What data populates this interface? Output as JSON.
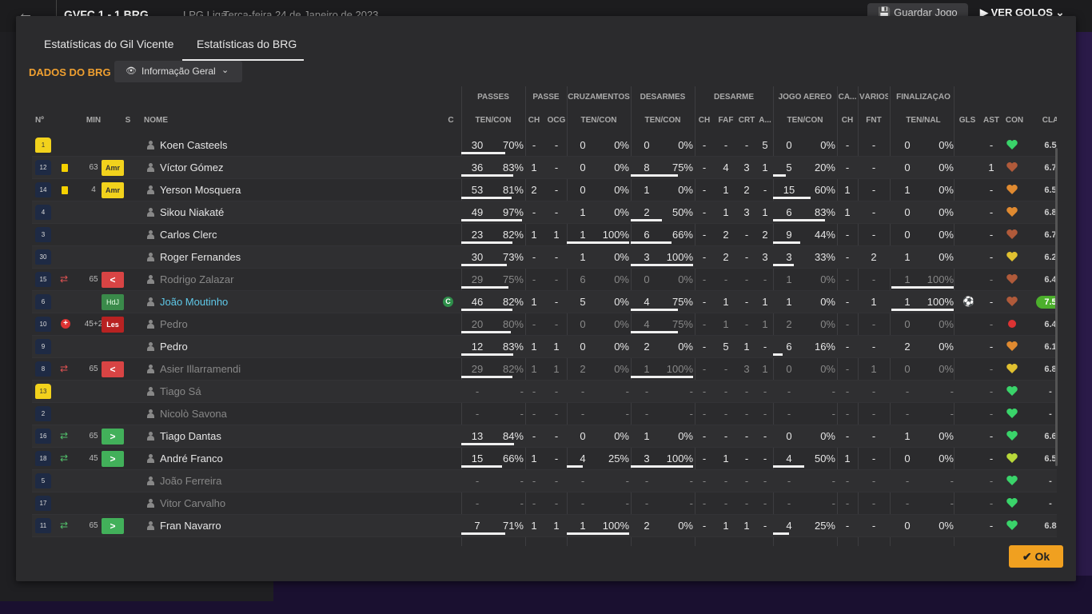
{
  "background": {
    "score": "GVFC 1 - 1 BRG",
    "league": "LPG Liga",
    "date": "Terça-feira 24 de Janeiro de 2023",
    "save_label": "Guardar Jogo",
    "goals_label": "VER GOLOS"
  },
  "tabs": [
    {
      "label": "Estatísticas do Gil Vicente",
      "active": false
    },
    {
      "label": "Estatísticas do BRG",
      "active": true
    }
  ],
  "team_title": "DADOS DO BRG",
  "view_dropdown": {
    "label": "Informação Geral"
  },
  "groups": [
    "PASSES",
    "PASSE",
    "CRUZAMENTOS",
    "DESARMES",
    "DESARME",
    "JOGO AÉREO",
    "CA...",
    "VÁRIOS",
    "FINALIZAÇÃO"
  ],
  "columns": [
    "Nº",
    "MIN",
    "S",
    "NOME",
    "C",
    "TEN/CON",
    "CH",
    "OCG",
    "TEN/CON",
    "TEN/CON",
    "CH",
    "FAF",
    "CRT",
    "A...",
    "TEN/CON",
    "CH",
    "FNT",
    "TEN/NAL",
    "GLS",
    "AST",
    "CON",
    "CLA"
  ],
  "colors": {
    "accent": "#f0a030",
    "best_rating": "#4caf2c",
    "ok_button": "#f0a020"
  },
  "players": [
    {
      "num": "1",
      "gk": true,
      "min": "",
      "card": "",
      "sub": "",
      "status": "",
      "name": "Koen Casteels",
      "active": true,
      "cap": false,
      "pass": [
        "30",
        "70%"
      ],
      "passp": 0.7,
      "ch": "-",
      "ocg": "-",
      "cru": [
        "0",
        "0%"
      ],
      "crup": 0,
      "des": [
        "0",
        "0%"
      ],
      "desp": 0,
      "dch": "-",
      "faf": "-",
      "crt": "-",
      "a": "5",
      "aer": [
        "0",
        "0%"
      ],
      "aerp": 0,
      "cach": "-",
      "fnt": "-",
      "fin": [
        "0",
        "0%"
      ],
      "finp": 0,
      "gls": "",
      "ast": "-",
      "con": "green",
      "cla": "6.5",
      "best": false
    },
    {
      "num": "12",
      "gk": false,
      "min": "63",
      "card": "yellow",
      "sub": "",
      "status": "Amr",
      "name": "Víctor Gómez",
      "active": true,
      "cap": false,
      "pass": [
        "36",
        "83%"
      ],
      "passp": 0.83,
      "ch": "1",
      "ocg": "-",
      "cru": [
        "0",
        "0%"
      ],
      "crup": 0,
      "des": [
        "8",
        "75%"
      ],
      "desp": 0.75,
      "dch": "-",
      "faf": "4",
      "crt": "3",
      "a": "1",
      "aer": [
        "5",
        "20%"
      ],
      "aerp": 0.2,
      "cach": "-",
      "fnt": "-",
      "fin": [
        "0",
        "0%"
      ],
      "finp": 0,
      "gls": "",
      "ast": "1",
      "con": "brown",
      "cla": "6.7",
      "best": false
    },
    {
      "num": "14",
      "gk": false,
      "min": "4",
      "card": "yellow",
      "sub": "",
      "status": "Amr",
      "name": "Yerson Mosquera",
      "active": true,
      "cap": false,
      "pass": [
        "53",
        "81%"
      ],
      "passp": 0.81,
      "ch": "2",
      "ocg": "-",
      "cru": [
        "0",
        "0%"
      ],
      "crup": 0,
      "des": [
        "1",
        "0%"
      ],
      "desp": 0,
      "dch": "-",
      "faf": "1",
      "crt": "2",
      "a": "-",
      "aer": [
        "15",
        "60%"
      ],
      "aerp": 0.6,
      "cach": "1",
      "fnt": "-",
      "fin": [
        "1",
        "0%"
      ],
      "finp": 0,
      "gls": "",
      "ast": "-",
      "con": "orange",
      "cla": "6.5",
      "best": false
    },
    {
      "num": "4",
      "gk": false,
      "min": "",
      "card": "",
      "sub": "",
      "status": "",
      "name": "Sikou Niakaté",
      "active": true,
      "cap": false,
      "pass": [
        "49",
        "97%"
      ],
      "passp": 0.97,
      "ch": "-",
      "ocg": "-",
      "cru": [
        "1",
        "0%"
      ],
      "crup": 0,
      "des": [
        "2",
        "50%"
      ],
      "desp": 0.5,
      "dch": "-",
      "faf": "1",
      "crt": "3",
      "a": "1",
      "aer": [
        "6",
        "83%"
      ],
      "aerp": 0.83,
      "cach": "1",
      "fnt": "-",
      "fin": [
        "0",
        "0%"
      ],
      "finp": 0,
      "gls": "",
      "ast": "-",
      "con": "orange",
      "cla": "6.8",
      "best": false
    },
    {
      "num": "3",
      "gk": false,
      "min": "",
      "card": "",
      "sub": "",
      "status": "",
      "name": "Carlos Clerc",
      "active": true,
      "cap": false,
      "pass": [
        "23",
        "82%"
      ],
      "passp": 0.82,
      "ch": "1",
      "ocg": "1",
      "cru": [
        "1",
        "100%"
      ],
      "crup": 1,
      "des": [
        "6",
        "66%"
      ],
      "desp": 0.66,
      "dch": "-",
      "faf": "2",
      "crt": "-",
      "a": "2",
      "aer": [
        "9",
        "44%"
      ],
      "aerp": 0.44,
      "cach": "-",
      "fnt": "-",
      "fin": [
        "0",
        "0%"
      ],
      "finp": 0,
      "gls": "",
      "ast": "-",
      "con": "brown",
      "cla": "6.7",
      "best": false
    },
    {
      "num": "30",
      "gk": false,
      "min": "",
      "card": "",
      "sub": "",
      "status": "",
      "name": "Roger Fernandes",
      "active": true,
      "cap": false,
      "pass": [
        "30",
        "73%"
      ],
      "passp": 0.73,
      "ch": "-",
      "ocg": "-",
      "cru": [
        "1",
        "0%"
      ],
      "crup": 0,
      "des": [
        "3",
        "100%"
      ],
      "desp": 1,
      "dch": "-",
      "faf": "2",
      "crt": "-",
      "a": "3",
      "aer": [
        "3",
        "33%"
      ],
      "aerp": 0.33,
      "cach": "-",
      "fnt": "2",
      "fin": [
        "1",
        "0%"
      ],
      "finp": 0,
      "gls": "",
      "ast": "-",
      "con": "yellow",
      "cla": "6.2",
      "best": false
    },
    {
      "num": "15",
      "gk": false,
      "min": "65",
      "card": "",
      "sub": "out",
      "status": "out",
      "name": "Rodrigo Zalazar",
      "active": false,
      "cap": false,
      "pass": [
        "29",
        "75%"
      ],
      "passp": 0.75,
      "ch": "-",
      "ocg": "-",
      "cru": [
        "6",
        "0%"
      ],
      "crup": 0,
      "des": [
        "0",
        "0%"
      ],
      "desp": 0,
      "dch": "-",
      "faf": "-",
      "crt": "-",
      "a": "-",
      "aer": [
        "1",
        "0%"
      ],
      "aerp": 0,
      "cach": "-",
      "fnt": "-",
      "fin": [
        "1",
        "100%"
      ],
      "finp": 1,
      "gls": "",
      "ast": "-",
      "con": "brown",
      "cla": "6.4",
      "best": false
    },
    {
      "num": "6",
      "gk": false,
      "min": "",
      "card": "",
      "sub": "",
      "status": "HdJ",
      "name": "João Moutinho",
      "active": true,
      "cap": true,
      "cap_label": "C",
      "highlight": true,
      "pass": [
        "46",
        "82%"
      ],
      "passp": 0.82,
      "ch": "1",
      "ocg": "-",
      "cru": [
        "5",
        "0%"
      ],
      "crup": 0,
      "des": [
        "4",
        "75%"
      ],
      "desp": 0.75,
      "dch": "-",
      "faf": "1",
      "crt": "-",
      "a": "1",
      "aer": [
        "1",
        "0%"
      ],
      "aerp": 0,
      "cach": "-",
      "fnt": "1",
      "fin": [
        "1",
        "100%"
      ],
      "finp": 1,
      "gls": "ball",
      "ast": "-",
      "con": "brown",
      "cla": "7.5",
      "best": true
    },
    {
      "num": "10",
      "gk": false,
      "min": "45+2",
      "card": "injury",
      "sub": "",
      "status": "Les",
      "name": "Pedro",
      "active": false,
      "cap": false,
      "pass": [
        "20",
        "80%"
      ],
      "passp": 0.8,
      "ch": "-",
      "ocg": "-",
      "cru": [
        "0",
        "0%"
      ],
      "crup": 0,
      "des": [
        "4",
        "75%"
      ],
      "desp": 0.75,
      "dch": "-",
      "faf": "1",
      "crt": "-",
      "a": "1",
      "aer": [
        "2",
        "0%"
      ],
      "aerp": 0,
      "cach": "-",
      "fnt": "-",
      "fin": [
        "0",
        "0%"
      ],
      "finp": 0,
      "gls": "",
      "ast": "-",
      "con": "red",
      "cla": "6.4",
      "best": false
    },
    {
      "num": "9",
      "gk": false,
      "min": "",
      "card": "",
      "sub": "",
      "status": "",
      "name": "Pedro",
      "active": true,
      "cap": false,
      "pass": [
        "12",
        "83%"
      ],
      "passp": 0.83,
      "ch": "1",
      "ocg": "1",
      "cru": [
        "0",
        "0%"
      ],
      "crup": 0,
      "des": [
        "2",
        "0%"
      ],
      "desp": 0,
      "dch": "-",
      "faf": "5",
      "crt": "1",
      "a": "-",
      "aer": [
        "6",
        "16%"
      ],
      "aerp": 0.16,
      "cach": "-",
      "fnt": "-",
      "fin": [
        "2",
        "0%"
      ],
      "finp": 0,
      "gls": "",
      "ast": "-",
      "con": "orange",
      "cla": "6.1",
      "best": false
    },
    {
      "num": "8",
      "gk": false,
      "min": "65",
      "card": "",
      "sub": "out",
      "status": "out",
      "name": "Asier Illarramendi",
      "active": false,
      "cap": false,
      "pass": [
        "29",
        "82%"
      ],
      "passp": 0.82,
      "ch": "1",
      "ocg": "1",
      "cru": [
        "2",
        "0%"
      ],
      "crup": 0,
      "des": [
        "1",
        "100%"
      ],
      "desp": 1,
      "dch": "-",
      "faf": "-",
      "crt": "3",
      "a": "1",
      "aer": [
        "0",
        "0%"
      ],
      "aerp": 0,
      "cach": "-",
      "fnt": "1",
      "fin": [
        "0",
        "0%"
      ],
      "finp": 0,
      "gls": "",
      "ast": "-",
      "con": "yellow",
      "cla": "6.8",
      "best": false
    },
    {
      "num": "13",
      "gk": true,
      "min": "",
      "card": "",
      "sub": "",
      "status": "",
      "name": "Tiago Sá",
      "active": false,
      "cap": false,
      "pass": [
        "-",
        "-"
      ],
      "passp": 0,
      "ch": "-",
      "ocg": "-",
      "cru": [
        "-",
        "-"
      ],
      "crup": 0,
      "des": [
        "-",
        "-"
      ],
      "desp": 0,
      "dch": "-",
      "faf": "-",
      "crt": "-",
      "a": "-",
      "aer": [
        "-",
        "-"
      ],
      "aerp": 0,
      "cach": "-",
      "fnt": "-",
      "fin": [
        "-",
        "-"
      ],
      "finp": 0,
      "gls": "",
      "ast": "-",
      "con": "green",
      "cla": "-",
      "best": false
    },
    {
      "num": "2",
      "gk": false,
      "min": "",
      "card": "",
      "sub": "",
      "status": "",
      "name": "Nicolò Savona",
      "active": false,
      "cap": false,
      "pass": [
        "-",
        "-"
      ],
      "passp": 0,
      "ch": "-",
      "ocg": "-",
      "cru": [
        "-",
        "-"
      ],
      "crup": 0,
      "des": [
        "-",
        "-"
      ],
      "desp": 0,
      "dch": "-",
      "faf": "-",
      "crt": "-",
      "a": "-",
      "aer": [
        "-",
        "-"
      ],
      "aerp": 0,
      "cach": "-",
      "fnt": "-",
      "fin": [
        "-",
        "-"
      ],
      "finp": 0,
      "gls": "",
      "ast": "-",
      "con": "green",
      "cla": "-",
      "best": false
    },
    {
      "num": "16",
      "gk": false,
      "min": "65",
      "card": "",
      "sub": "in",
      "status": "in",
      "name": "Tiago Dantas",
      "active": true,
      "cap": false,
      "pass": [
        "13",
        "84%"
      ],
      "passp": 0.84,
      "ch": "-",
      "ocg": "-",
      "cru": [
        "0",
        "0%"
      ],
      "crup": 0,
      "des": [
        "1",
        "0%"
      ],
      "desp": 0,
      "dch": "-",
      "faf": "-",
      "crt": "-",
      "a": "-",
      "aer": [
        "0",
        "0%"
      ],
      "aerp": 0,
      "cach": "-",
      "fnt": "-",
      "fin": [
        "1",
        "0%"
      ],
      "finp": 0,
      "gls": "",
      "ast": "-",
      "con": "green",
      "cla": "6.6",
      "best": false
    },
    {
      "num": "18",
      "gk": false,
      "min": "45",
      "card": "",
      "sub": "in",
      "status": "in",
      "name": "André Franco",
      "active": true,
      "cap": false,
      "pass": [
        "15",
        "66%"
      ],
      "passp": 0.66,
      "ch": "1",
      "ocg": "-",
      "cru": [
        "4",
        "25%"
      ],
      "crup": 0.25,
      "des": [
        "3",
        "100%"
      ],
      "desp": 1,
      "dch": "-",
      "faf": "1",
      "crt": "-",
      "a": "-",
      "aer": [
        "4",
        "50%"
      ],
      "aerp": 0.5,
      "cach": "1",
      "fnt": "-",
      "fin": [
        "0",
        "0%"
      ],
      "finp": 0,
      "gls": "",
      "ast": "-",
      "con": "yellowgreen",
      "cla": "6.5",
      "best": false
    },
    {
      "num": "5",
      "gk": false,
      "min": "",
      "card": "",
      "sub": "",
      "status": "",
      "name": "João Ferreira",
      "active": false,
      "cap": false,
      "pass": [
        "-",
        "-"
      ],
      "passp": 0,
      "ch": "-",
      "ocg": "-",
      "cru": [
        "-",
        "-"
      ],
      "crup": 0,
      "des": [
        "-",
        "-"
      ],
      "desp": 0,
      "dch": "-",
      "faf": "-",
      "crt": "-",
      "a": "-",
      "aer": [
        "-",
        "-"
      ],
      "aerp": 0,
      "cach": "-",
      "fnt": "-",
      "fin": [
        "-",
        "-"
      ],
      "finp": 0,
      "gls": "",
      "ast": "-",
      "con": "green",
      "cla": "-",
      "best": false
    },
    {
      "num": "17",
      "gk": false,
      "min": "",
      "card": "",
      "sub": "",
      "status": "",
      "name": "Vitor Carvalho",
      "active": false,
      "cap": false,
      "pass": [
        "-",
        "-"
      ],
      "passp": 0,
      "ch": "-",
      "ocg": "-",
      "cru": [
        "-",
        "-"
      ],
      "crup": 0,
      "des": [
        "-",
        "-"
      ],
      "desp": 0,
      "dch": "-",
      "faf": "-",
      "crt": "-",
      "a": "-",
      "aer": [
        "-",
        "-"
      ],
      "aerp": 0,
      "cach": "-",
      "fnt": "-",
      "fin": [
        "-",
        "-"
      ],
      "finp": 0,
      "gls": "",
      "ast": "-",
      "con": "green",
      "cla": "-",
      "best": false
    },
    {
      "num": "11",
      "gk": false,
      "min": "65",
      "card": "",
      "sub": "in",
      "status": "in",
      "name": "Fran Navarro",
      "active": true,
      "cap": false,
      "pass": [
        "7",
        "71%"
      ],
      "passp": 0.71,
      "ch": "1",
      "ocg": "1",
      "cru": [
        "1",
        "100%"
      ],
      "crup": 1,
      "des": [
        "2",
        "0%"
      ],
      "desp": 0,
      "dch": "-",
      "faf": "1",
      "crt": "1",
      "a": "-",
      "aer": [
        "4",
        "25%"
      ],
      "aerp": 0.25,
      "cach": "-",
      "fnt": "-",
      "fin": [
        "0",
        "0%"
      ],
      "finp": 0,
      "gls": "",
      "ast": "-",
      "con": "green",
      "cla": "6.8",
      "best": false
    }
  ],
  "ok_label": "Ok"
}
